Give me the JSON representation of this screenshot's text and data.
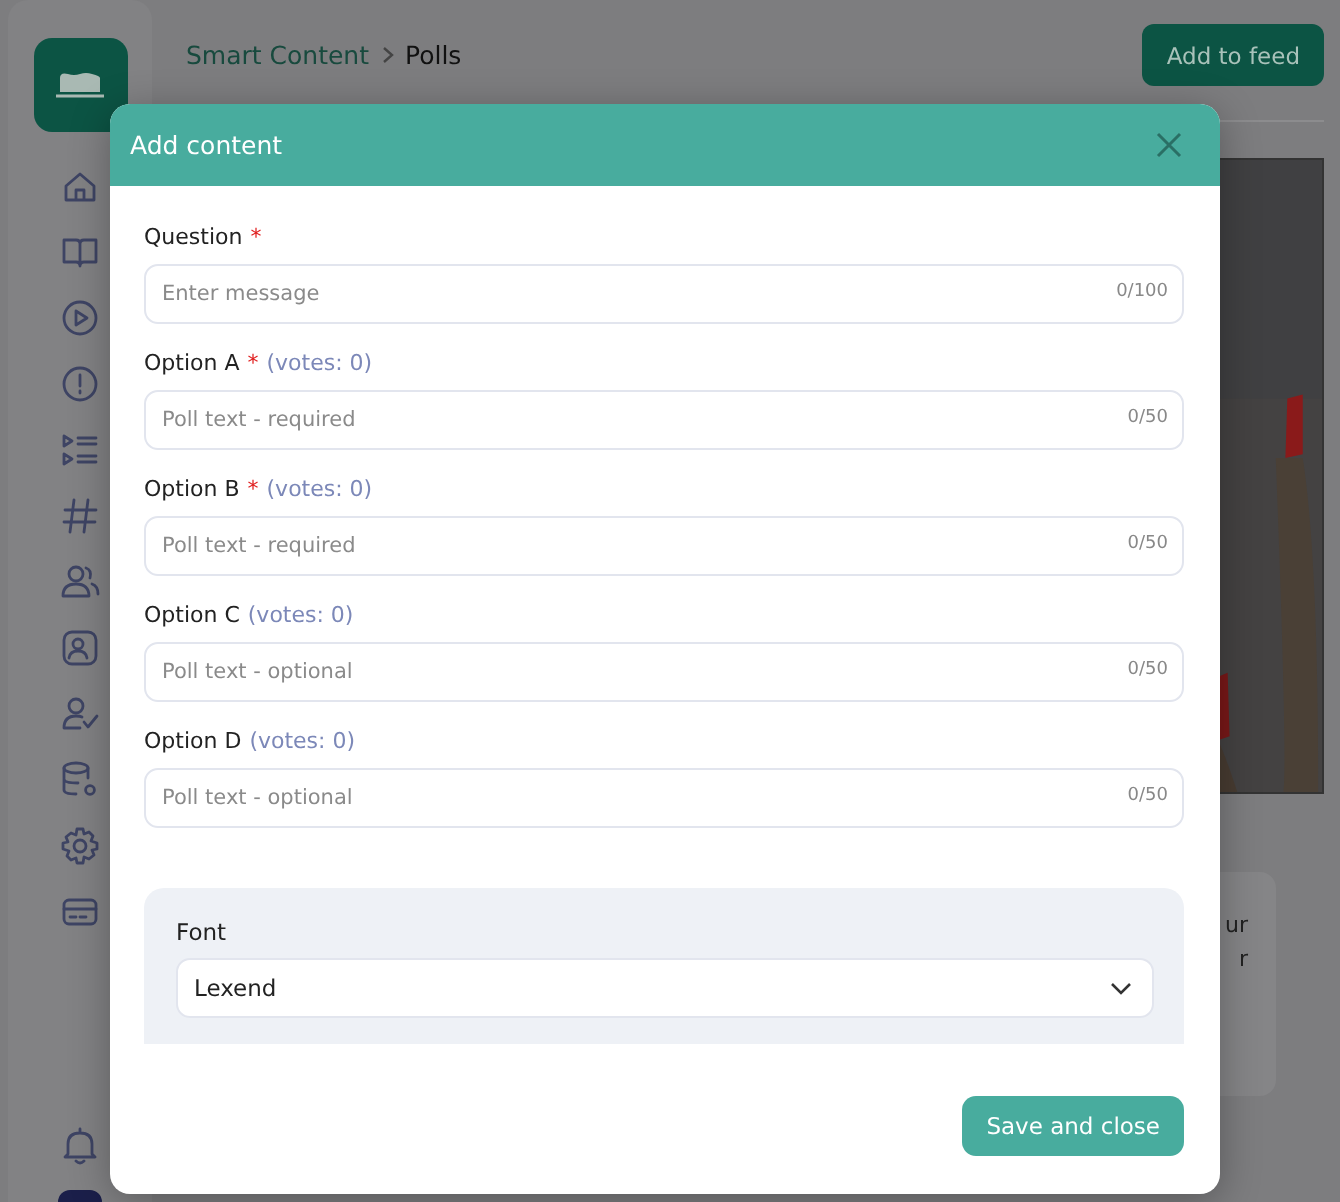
{
  "header": {
    "breadcrumb": [
      "Smart Content",
      "Polls"
    ],
    "add_button": "Add to feed"
  },
  "background_card": {
    "lines": [
      "ur",
      "r"
    ]
  },
  "modal": {
    "title": "Add content",
    "required_mark": "*",
    "fields": [
      {
        "label": "Question",
        "required": true,
        "placeholder": "Enter message",
        "counter": "0/100"
      },
      {
        "label": "Option A",
        "required": true,
        "votes": "(votes: 0)",
        "placeholder": "Poll text - required",
        "counter": "0/50"
      },
      {
        "label": "Option B",
        "required": true,
        "votes": "(votes: 0)",
        "placeholder": "Poll text - required",
        "counter": "0/50"
      },
      {
        "label": "Option C",
        "required": false,
        "votes": "(votes: 0)",
        "placeholder": "Poll text - optional",
        "counter": "0/50"
      },
      {
        "label": "Option D",
        "required": false,
        "votes": "(votes: 0)",
        "placeholder": "Poll text - optional",
        "counter": "0/50"
      }
    ],
    "font": {
      "label": "Font",
      "value": "Lexend"
    },
    "save_button": "Save and close"
  }
}
